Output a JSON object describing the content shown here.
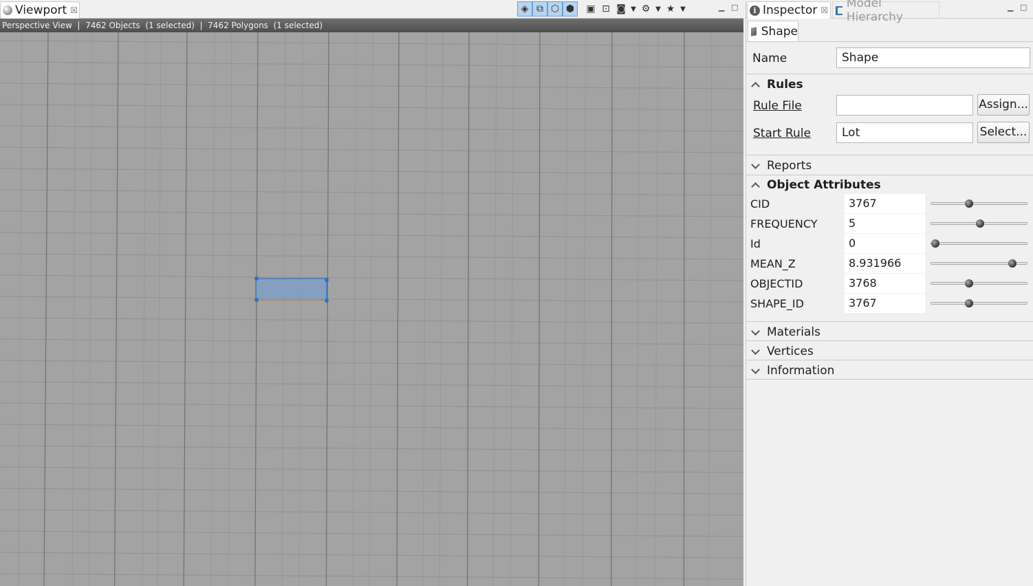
{
  "viewport": {
    "tab_label": "Viewport",
    "status": "Perspective View  |  7462 Objects  (1 selected)  |  7462 Polygons  (1 selected)"
  },
  "inspector": {
    "tab_label": "Inspector",
    "hierarchy_tab_label": "Model Hierarchy",
    "shape_tab_label": "Shape",
    "name_label": "Name",
    "name_value": "Shape",
    "rules": {
      "title": "Rules",
      "rule_file_label": "Rule File",
      "rule_file_value": "",
      "assign_button": "Assign...",
      "start_rule_label": "Start Rule",
      "start_rule_value": "Lot",
      "select_button": "Select..."
    },
    "reports_title": "Reports",
    "object_attributes": {
      "title": "Object Attributes",
      "rows": [
        {
          "name": "CID",
          "value": "3767",
          "slider": 0.38
        },
        {
          "name": "FREQUENCY",
          "value": "5",
          "slider": 0.5
        },
        {
          "name": "Id",
          "value": "0",
          "slider": 0.0
        },
        {
          "name": "MEAN_Z",
          "value": "8.931966",
          "slider": 0.87
        },
        {
          "name": "OBJECTID",
          "value": "3768",
          "slider": 0.38
        },
        {
          "name": "SHAPE_ID",
          "value": "3767",
          "slider": 0.38
        }
      ]
    },
    "materials_title": "Materials",
    "vertices_title": "Vertices",
    "information_title": "Information"
  },
  "colors": {
    "viewport_bg": "#a3a3a3",
    "selection_fill": "#7d9fc6",
    "selection_stroke": "#2f6fc7"
  },
  "icons": {
    "viewport": "sphere-icon",
    "inspector": "info-icon",
    "hierarchy": "hierarchy-icon",
    "shape": "cube-icon"
  }
}
